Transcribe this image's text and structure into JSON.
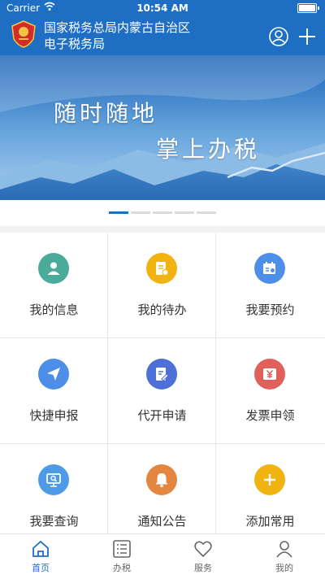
{
  "status_bar": {
    "carrier": "Carrier",
    "time": "10:54 AM"
  },
  "header": {
    "title_line1": "国家税务总局内蒙古自治区",
    "title_line2": "电子税务局"
  },
  "banner": {
    "slogan_line1": "随时随地",
    "slogan_line2": "掌上办税",
    "slide_count": 5,
    "active_slide": 1
  },
  "grid": {
    "items": [
      {
        "label": "我的信息",
        "icon": "user-icon",
        "color": "#4aab9a"
      },
      {
        "label": "我的待办",
        "icon": "document-icon",
        "color": "#f1b310"
      },
      {
        "label": "我要预约",
        "icon": "calendar-icon",
        "color": "#4c8ee8"
      },
      {
        "label": "快捷申报",
        "icon": "paper-plane-icon",
        "color": "#4c8ee8"
      },
      {
        "label": "代开申请",
        "icon": "edit-document-icon",
        "color": "#4c6fd8"
      },
      {
        "label": "发票申领",
        "icon": "yuan-icon",
        "color": "#e0605c"
      },
      {
        "label": "我要查询",
        "icon": "monitor-icon",
        "color": "#4c9ae8"
      },
      {
        "label": "通知公告",
        "icon": "bell-icon",
        "color": "#e28640"
      },
      {
        "label": "添加常用",
        "icon": "plus-icon",
        "color": "#f1b310"
      }
    ]
  },
  "tabbar": {
    "items": [
      {
        "label": "首页",
        "icon": "home-icon",
        "active": true
      },
      {
        "label": "办税",
        "icon": "list-icon",
        "active": false
      },
      {
        "label": "服务",
        "icon": "heart-icon",
        "active": false
      },
      {
        "label": "我的",
        "icon": "person-icon",
        "active": false
      }
    ]
  },
  "colors": {
    "primary": "#1e6fc4",
    "tab_active": "#1e6fc4",
    "tab_inactive": "#666666"
  }
}
